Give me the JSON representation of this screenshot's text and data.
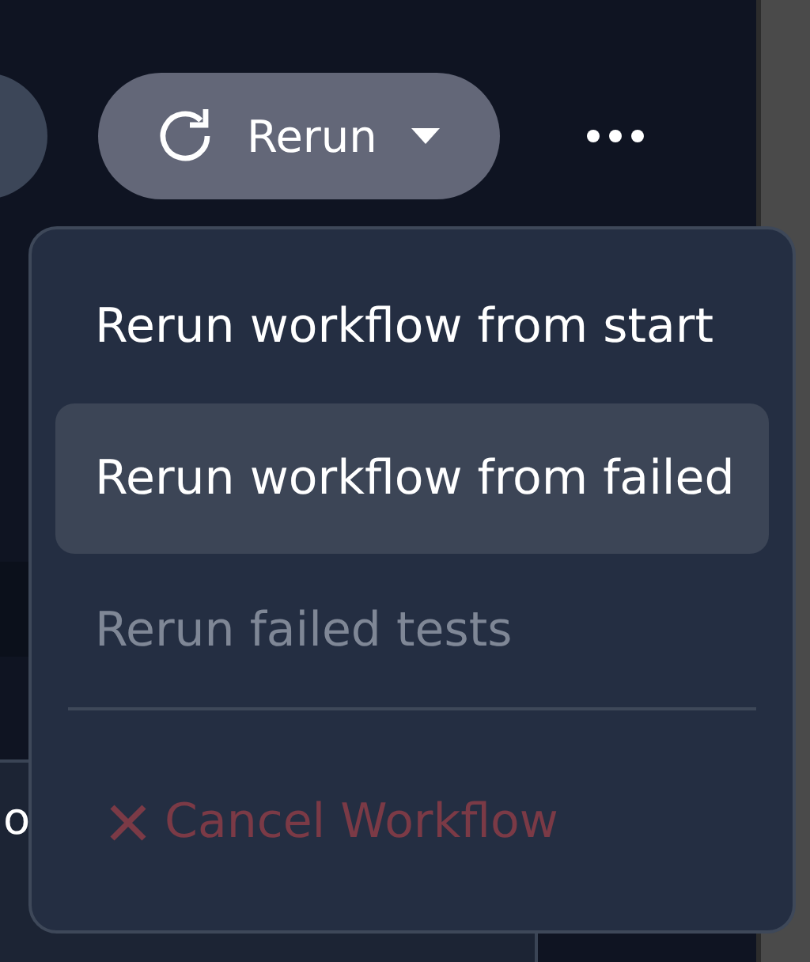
{
  "toolbar": {
    "rerun_button": {
      "label": "Rerun"
    }
  },
  "background_panel": {
    "texts": [
      "o"
    ]
  },
  "menu": {
    "items": [
      {
        "kind": "action",
        "label": "Rerun workflow from start",
        "selected": false,
        "disabled": false
      },
      {
        "kind": "action",
        "label": "Rerun workflow from failed",
        "selected": true,
        "disabled": false
      },
      {
        "kind": "action",
        "label": "Rerun failed tests",
        "selected": false,
        "disabled": true
      },
      {
        "kind": "divider"
      },
      {
        "kind": "danger",
        "label": "Cancel Workflow",
        "selected": false,
        "disabled": true
      }
    ]
  }
}
